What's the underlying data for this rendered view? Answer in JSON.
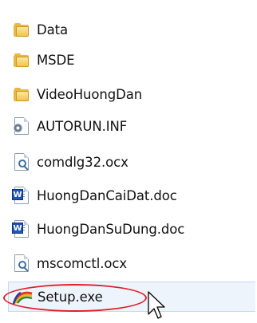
{
  "file_list": {
    "items": [
      {
        "name": "Data",
        "icon": "folder-icon"
      },
      {
        "name": "MSDE",
        "icon": "folder-icon"
      },
      {
        "name": "VideoHuongDan",
        "icon": "folder-icon"
      },
      {
        "name": "AUTORUN.INF",
        "icon": "settings-file-icon"
      },
      {
        "name": "comdlg32.ocx",
        "icon": "activex-control-icon"
      },
      {
        "name": "HuongDanCaiDat.doc",
        "icon": "word-document-icon"
      },
      {
        "name": "HuongDanSuDung.doc",
        "icon": "word-document-icon"
      },
      {
        "name": "mscomctl.ocx",
        "icon": "activex-control-icon"
      },
      {
        "name": "Setup.exe",
        "icon": "setup-icon",
        "selected": true
      }
    ]
  },
  "colors": {
    "folder": "#e7b843",
    "highlight_ring": "#e0202a",
    "selection_bg": "#eef4fb",
    "word_blue": "#1f55b3"
  }
}
